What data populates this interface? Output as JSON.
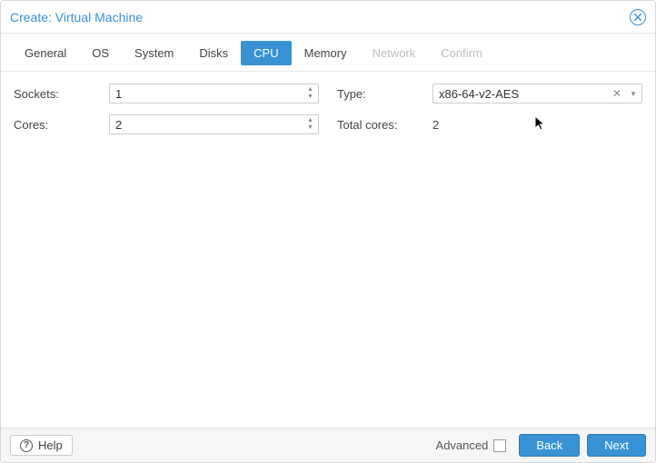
{
  "title": "Create: Virtual Machine",
  "tabs": [
    {
      "label": "General",
      "state": "normal"
    },
    {
      "label": "OS",
      "state": "normal"
    },
    {
      "label": "System",
      "state": "normal"
    },
    {
      "label": "Disks",
      "state": "normal"
    },
    {
      "label": "CPU",
      "state": "active"
    },
    {
      "label": "Memory",
      "state": "normal"
    },
    {
      "label": "Network",
      "state": "disabled"
    },
    {
      "label": "Confirm",
      "state": "disabled"
    }
  ],
  "left": {
    "sockets": {
      "label": "Sockets:",
      "value": "1"
    },
    "cores": {
      "label": "Cores:",
      "value": "2"
    }
  },
  "right": {
    "type": {
      "label": "Type:",
      "value": "x86-64-v2-AES"
    },
    "totalcores": {
      "label": "Total cores:",
      "value": "2"
    }
  },
  "footer": {
    "help": "Help",
    "advanced": "Advanced",
    "back": "Back",
    "next": "Next"
  }
}
